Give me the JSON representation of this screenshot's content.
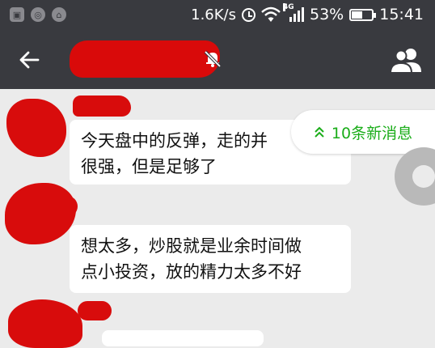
{
  "status_bar": {
    "network_speed": "1.6K/s",
    "network_type": "4G",
    "battery_percent": "53%",
    "battery_level": 0.53,
    "time": "15:41",
    "app_icons": [
      "gallery-icon",
      "sync-icon",
      "browser-icon"
    ],
    "icons": [
      "alarm-icon",
      "wifi-icon",
      "signal-icon",
      "battery-icon"
    ]
  },
  "title_bar": {
    "title": "",
    "muted": true,
    "icons": [
      "back-arrow-icon",
      "mute-bell-icon",
      "group-members-icon"
    ]
  },
  "messages": [
    {
      "sender": "",
      "lines": [
        "今天盘中的反弹，走的并",
        "很强，但是足够了"
      ]
    },
    {
      "sender": "",
      "lines": [
        "想太多，炒股就是业余时间做",
        "点小投资，放的精力太多不好"
      ]
    }
  ],
  "new_messages_pill": {
    "label": "10条新消息",
    "icon": "double-chevron-up-icon"
  },
  "colors": {
    "bar_background": "#393a3f",
    "chat_background": "#ebebeb",
    "accent_green": "#1aad19",
    "redaction_red": "#d80c0c",
    "bubble_background": "#ffffff"
  }
}
